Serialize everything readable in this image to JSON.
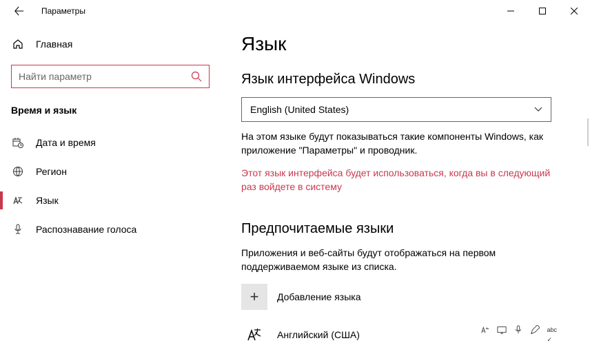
{
  "titlebar": {
    "title": "Параметры"
  },
  "sidebar": {
    "home": "Главная",
    "searchPlaceholder": "Найти параметр",
    "category": "Время и язык",
    "items": [
      {
        "label": "Дата и время"
      },
      {
        "label": "Регион"
      },
      {
        "label": "Язык"
      },
      {
        "label": "Распознавание голоса"
      }
    ]
  },
  "main": {
    "pageTitle": "Язык",
    "displayLang": {
      "heading": "Язык интерфейса Windows",
      "selected": "English (United States)",
      "desc": "На этом языке будут показываться такие компоненты Windows, как приложение \"Параметры\" и проводник.",
      "warning": "Этот язык интерфейса будет использоваться, когда вы в следующий раз войдете в систему"
    },
    "preferred": {
      "heading": "Предпочитаемые языки",
      "desc": "Приложения и веб-сайты будут отображаться на первом поддерживаемом языке из списка.",
      "addLabel": "Добавление языка",
      "langs": [
        {
          "name": "Английский (США)"
        }
      ]
    }
  }
}
